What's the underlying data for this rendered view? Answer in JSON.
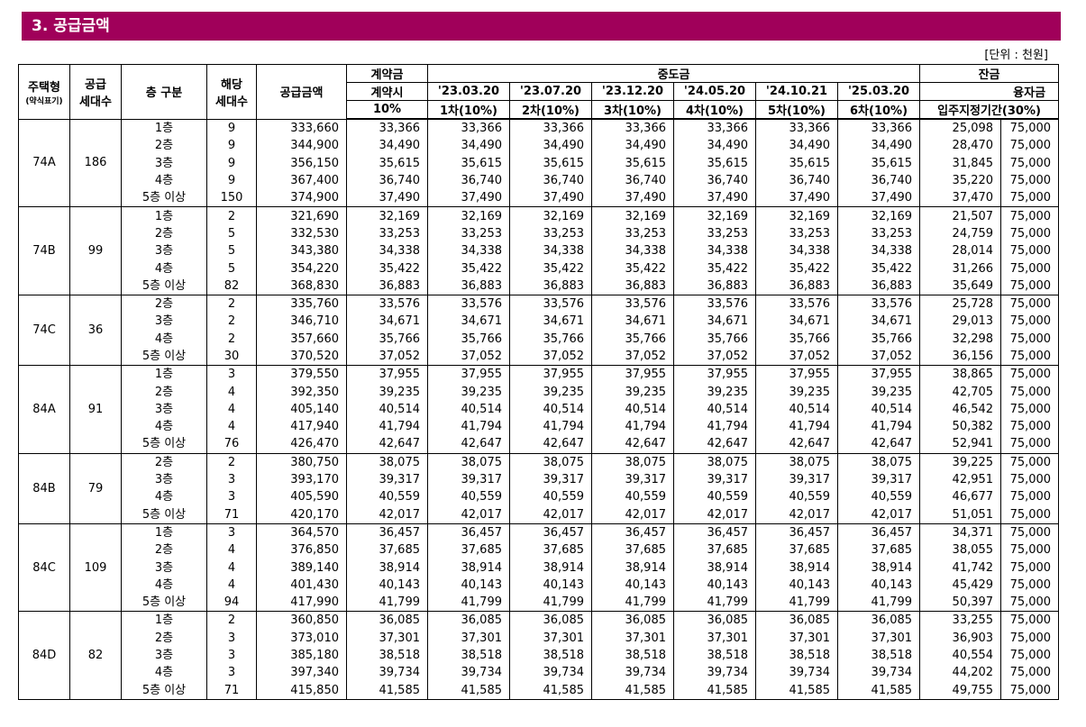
{
  "section_title": "3. 공급금액",
  "unit_note": "[단위 : 천원]",
  "headers": {
    "house_type": "주택형",
    "house_type_sub": "(약식표기)",
    "supply_units": "공급\n세대수",
    "floor": "층 구분",
    "units": "해당\n세대수",
    "price": "공급금액",
    "contract": "계약금",
    "contract_sub": "계약시",
    "contract_pct": "10%",
    "middle": "중도금",
    "middle_dates": [
      "'23.03.20",
      "'23.07.20",
      "'23.12.20",
      "'24.05.20",
      "'24.10.21",
      "'25.03.20"
    ],
    "middle_rounds": [
      "1차(10%)",
      "2차(10%)",
      "3차(10%)",
      "4차(10%)",
      "5차(10%)",
      "6차(10%)"
    ],
    "balance": "잔금",
    "balance_move": "입주지정기간(30%)",
    "balance_loan": "융자금"
  },
  "groups": [
    {
      "type": "74A",
      "total": "186",
      "rows": [
        [
          "1층",
          "9",
          "333,660",
          "33,366",
          "33,366",
          "25,098",
          "75,000"
        ],
        [
          "2층",
          "9",
          "344,900",
          "34,490",
          "34,490",
          "28,470",
          "75,000"
        ],
        [
          "3층",
          "9",
          "356,150",
          "35,615",
          "35,615",
          "31,845",
          "75,000"
        ],
        [
          "4층",
          "9",
          "367,400",
          "36,740",
          "36,740",
          "35,220",
          "75,000"
        ],
        [
          "5층 이상",
          "150",
          "374,900",
          "37,490",
          "37,490",
          "37,470",
          "75,000"
        ]
      ]
    },
    {
      "type": "74B",
      "total": "99",
      "rows": [
        [
          "1층",
          "2",
          "321,690",
          "32,169",
          "32,169",
          "21,507",
          "75,000"
        ],
        [
          "2층",
          "5",
          "332,530",
          "33,253",
          "33,253",
          "24,759",
          "75,000"
        ],
        [
          "3층",
          "5",
          "343,380",
          "34,338",
          "34,338",
          "28,014",
          "75,000"
        ],
        [
          "4층",
          "5",
          "354,220",
          "35,422",
          "35,422",
          "31,266",
          "75,000"
        ],
        [
          "5층 이상",
          "82",
          "368,830",
          "36,883",
          "36,883",
          "35,649",
          "75,000"
        ]
      ]
    },
    {
      "type": "74C",
      "total": "36",
      "rows": [
        [
          "2층",
          "2",
          "335,760",
          "33,576",
          "33,576",
          "25,728",
          "75,000"
        ],
        [
          "3층",
          "2",
          "346,710",
          "34,671",
          "34,671",
          "29,013",
          "75,000"
        ],
        [
          "4층",
          "2",
          "357,660",
          "35,766",
          "35,766",
          "32,298",
          "75,000"
        ],
        [
          "5층 이상",
          "30",
          "370,520",
          "37,052",
          "37,052",
          "36,156",
          "75,000"
        ]
      ]
    },
    {
      "type": "84A",
      "total": "91",
      "rows": [
        [
          "1층",
          "3",
          "379,550",
          "37,955",
          "37,955",
          "38,865",
          "75,000"
        ],
        [
          "2층",
          "4",
          "392,350",
          "39,235",
          "39,235",
          "42,705",
          "75,000"
        ],
        [
          "3층",
          "4",
          "405,140",
          "40,514",
          "40,514",
          "46,542",
          "75,000"
        ],
        [
          "4층",
          "4",
          "417,940",
          "41,794",
          "41,794",
          "50,382",
          "75,000"
        ],
        [
          "5층 이상",
          "76",
          "426,470",
          "42,647",
          "42,647",
          "52,941",
          "75,000"
        ]
      ]
    },
    {
      "type": "84B",
      "total": "79",
      "rows": [
        [
          "2층",
          "2",
          "380,750",
          "38,075",
          "38,075",
          "39,225",
          "75,000"
        ],
        [
          "3층",
          "3",
          "393,170",
          "39,317",
          "39,317",
          "42,951",
          "75,000"
        ],
        [
          "4층",
          "3",
          "405,590",
          "40,559",
          "40,559",
          "46,677",
          "75,000"
        ],
        [
          "5층 이상",
          "71",
          "420,170",
          "42,017",
          "42,017",
          "51,051",
          "75,000"
        ]
      ]
    },
    {
      "type": "84C",
      "total": "109",
      "rows": [
        [
          "1층",
          "3",
          "364,570",
          "36,457",
          "36,457",
          "34,371",
          "75,000"
        ],
        [
          "2층",
          "4",
          "376,850",
          "37,685",
          "37,685",
          "38,055",
          "75,000"
        ],
        [
          "3층",
          "4",
          "389,140",
          "38,914",
          "38,914",
          "41,742",
          "75,000"
        ],
        [
          "4층",
          "4",
          "401,430",
          "40,143",
          "40,143",
          "45,429",
          "75,000"
        ],
        [
          "5층 이상",
          "94",
          "417,990",
          "41,799",
          "41,799",
          "50,397",
          "75,000"
        ]
      ]
    },
    {
      "type": "84D",
      "total": "82",
      "rows": [
        [
          "1층",
          "2",
          "360,850",
          "36,085",
          "36,085",
          "33,255",
          "75,000"
        ],
        [
          "2층",
          "3",
          "373,010",
          "37,301",
          "37,301",
          "36,903",
          "75,000"
        ],
        [
          "3층",
          "3",
          "385,180",
          "38,518",
          "38,518",
          "40,554",
          "75,000"
        ],
        [
          "4층",
          "3",
          "397,340",
          "39,734",
          "39,734",
          "44,202",
          "75,000"
        ],
        [
          "5층 이상",
          "71",
          "415,850",
          "41,585",
          "41,585",
          "49,755",
          "75,000"
        ]
      ]
    }
  ]
}
